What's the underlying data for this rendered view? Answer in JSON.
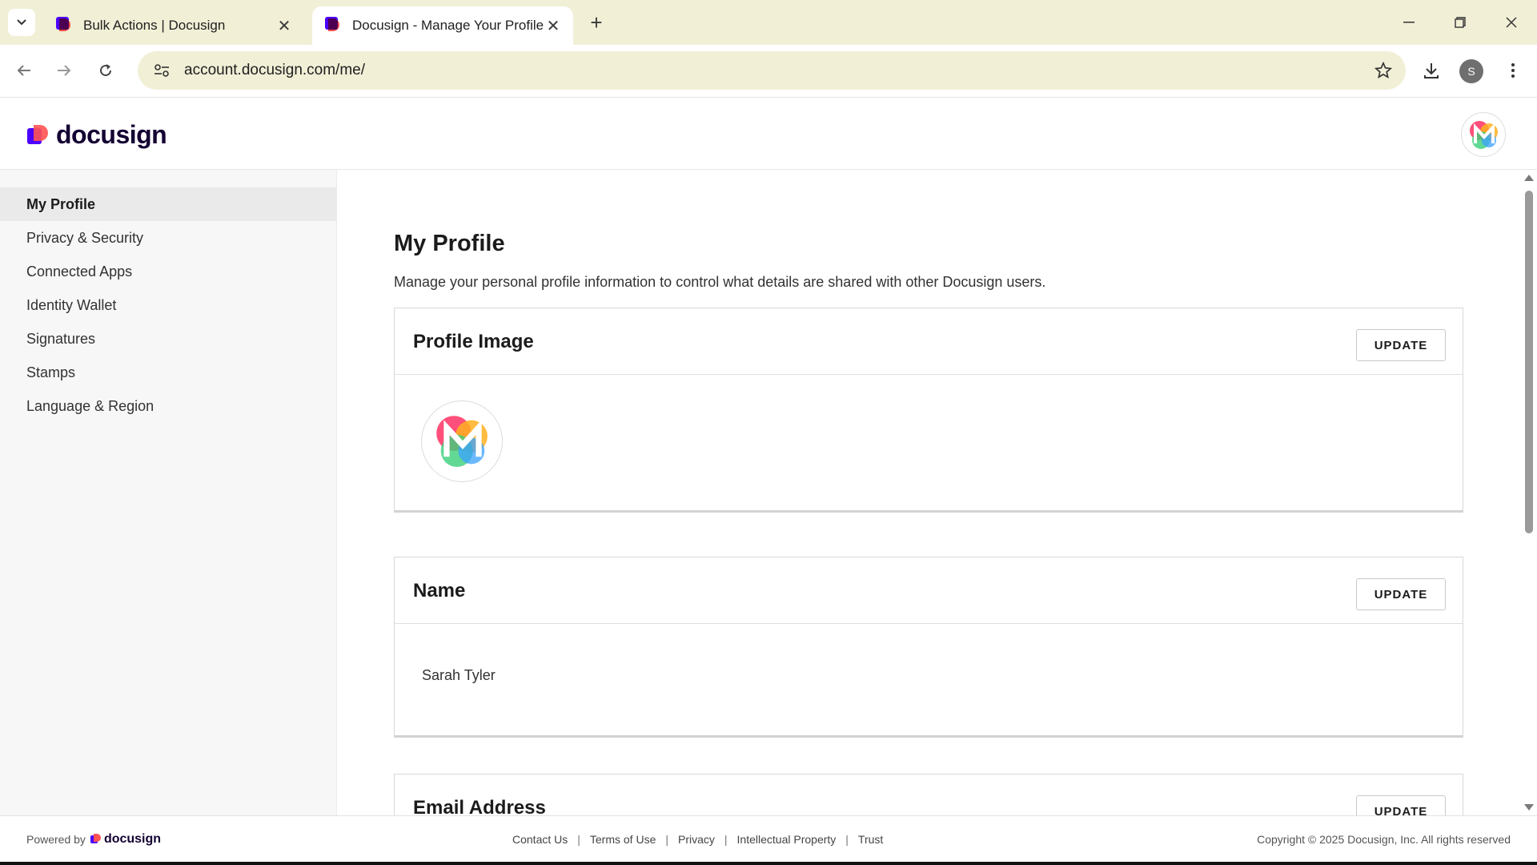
{
  "browser": {
    "tabs": [
      {
        "title": "Bulk Actions | Docusign",
        "active": false
      },
      {
        "title": "Docusign - Manage Your Profile",
        "active": true
      }
    ],
    "url": "account.docusign.com/me/",
    "profile_initial": "S"
  },
  "app": {
    "logo_text": "docusign"
  },
  "sidebar": {
    "items": [
      {
        "label": "My Profile",
        "active": true
      },
      {
        "label": "Privacy & Security",
        "active": false
      },
      {
        "label": "Connected Apps",
        "active": false
      },
      {
        "label": "Identity Wallet",
        "active": false
      },
      {
        "label": "Signatures",
        "active": false
      },
      {
        "label": "Stamps",
        "active": false
      },
      {
        "label": "Language & Region",
        "active": false
      }
    ]
  },
  "main": {
    "title": "My Profile",
    "description": "Manage your personal profile information to control what details are shared with other Docusign users.",
    "sections": {
      "profile_image": {
        "title": "Profile Image",
        "button": "UPDATE"
      },
      "name": {
        "title": "Name",
        "button": "UPDATE",
        "value": "Sarah Tyler"
      },
      "email": {
        "title": "Email Address",
        "button": "UPDATE"
      }
    }
  },
  "footer": {
    "powered_by": "Powered by",
    "logo_text": "docusign",
    "links": [
      "Contact Us",
      "Terms of Use",
      "Privacy",
      "Intellectual Property",
      "Trust"
    ],
    "copyright": "Copyright © 2025 Docusign, Inc. All rights reserved"
  },
  "colors": {
    "brand_purple": "#4c00ff",
    "brand_coral": "#ff5252",
    "chrome_bg": "#f1efd6"
  }
}
